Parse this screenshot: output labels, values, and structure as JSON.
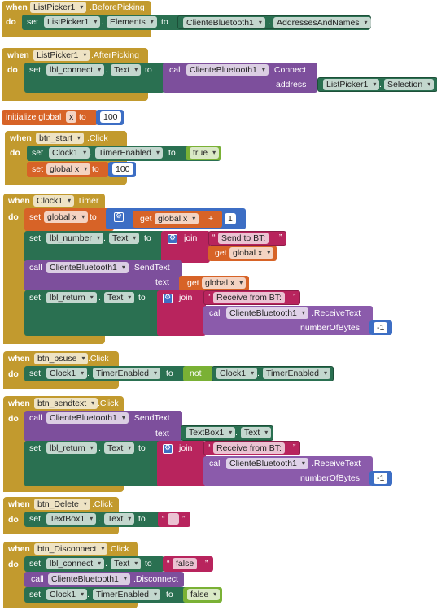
{
  "kw": {
    "when": "when",
    "do": "do",
    "set": "set",
    "to": "to",
    "call": "call",
    "get": "get",
    "join": "join",
    "not": "not",
    "initialize_global": "initialize global",
    "dot": ".",
    "plus": "+"
  },
  "b1": {
    "comp": "ListPicker1",
    "event": ".BeforePicking",
    "set_comp": "ListPicker1",
    "set_prop": "Elements",
    "val_comp": "ClienteBluetooth1",
    "val_prop": "AddressesAndNames"
  },
  "b2": {
    "comp": "ListPicker1",
    "event": ".AfterPicking",
    "set_comp": "lbl_connect",
    "set_prop": "Text",
    "call_comp": "ClienteBluetooth1",
    "method": ".Connect",
    "arg": "address",
    "arg_comp": "ListPicker1",
    "arg_prop": "Selection"
  },
  "b3": {
    "name": "x",
    "value": "100"
  },
  "b4": {
    "comp": "btn_start",
    "event": ".Click",
    "set_comp": "Clock1",
    "set_prop": "TimerEnabled",
    "bool_val": "true",
    "set2_var": "global x",
    "num_val": "100"
  },
  "b5": {
    "comp": "Clock1",
    "event": ".Timer",
    "var": "global x",
    "get_var": "global x",
    "num_val": "1",
    "set_comp": "lbl_number",
    "set_prop": "Text",
    "str1": "Send to BT: ",
    "get_var2": "global x",
    "call_comp": "ClienteBluetooth1",
    "method": ".SendText",
    "arg": "text",
    "get_var3": "global x",
    "set3_comp": "lbl_return",
    "set3_prop": "Text",
    "str2": "Receive from BT: ",
    "call2_comp": "ClienteBluetooth1",
    "method2": ".ReceiveText",
    "arg2": "numberOfBytes",
    "num2": "-1"
  },
  "b6": {
    "comp": "btn_psuse",
    "event": ".Click",
    "set_comp": "Clock1",
    "set_prop": "TimerEnabled",
    "val_comp": "Clock1",
    "val_prop": "TimerEnabled"
  },
  "b7": {
    "comp": "btn_sendtext",
    "event": ".Click",
    "call_comp": "ClienteBluetooth1",
    "method": ".SendText",
    "arg": "text",
    "arg_comp": "TextBox1",
    "arg_prop": "Text",
    "set_comp": "lbl_return",
    "set_prop": "Text",
    "str": "Receive from BT: ",
    "call2_comp": "ClienteBluetooth1",
    "method2": ".ReceiveText",
    "arg2": "numberOfBytes",
    "num": "-1"
  },
  "b8": {
    "comp": "btn_Delete",
    "event": ".Click",
    "set_comp": "TextBox1",
    "set_prop": "Text"
  },
  "b9": {
    "comp": "btn_Disconnect",
    "event": ".Click",
    "set_comp": "lbl_connect",
    "set_prop": "Text",
    "str": "false",
    "call_comp": "ClienteBluetooth1",
    "method": ".Disconnect",
    "set2_comp": "Clock1",
    "set2_prop": "TimerEnabled",
    "bool_val": "false"
  },
  "colors": {
    "event": "#c29a2e",
    "setter": "#2a7051",
    "procedure": "#7d4f9c",
    "variable": "#d76327",
    "text": "#b8245d",
    "logic": "#7ab135",
    "math": "#3d6ec4"
  }
}
